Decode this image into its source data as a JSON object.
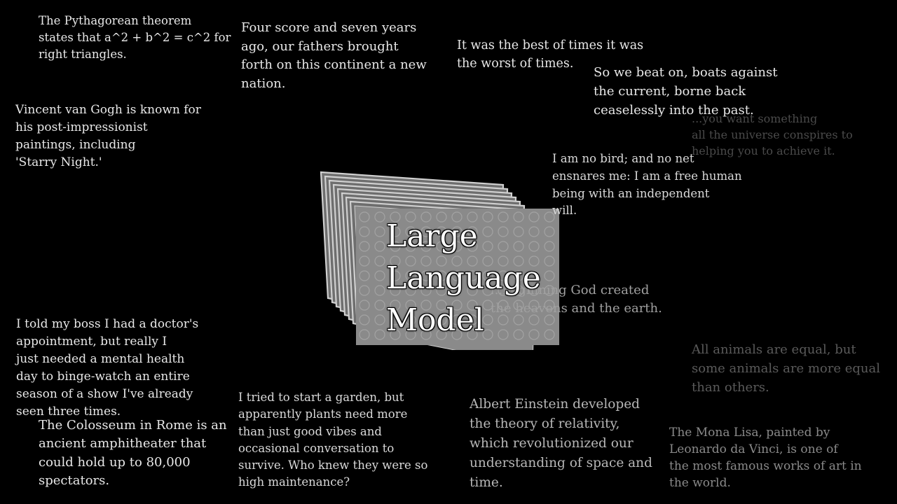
{
  "quotes": {
    "pythagorean": "The Pythagorean theorem\nstates that a^2 + b^2 = c^2 for\nright triangles.",
    "lincoln": "Four score and seven years\nago, our fathers brought\nforth on this continent a new\nnation.",
    "dickens": "It was the best of times it was\nthe worst of times.",
    "gatsby": "So we beat on, boats against\nthe current, borne back\nceaselessly into the past.",
    "faded_partial": "...you want something\nall the universe conspires to\nhelping you to achieve it.",
    "vangogh": "Vincent van Gogh is known for\nhis post-impressionist\npaintings, including\n'Starry Night.'",
    "bronte": "I am no bird; and no net\nensnares me: I am a free human\nbeing with an independent\nwill.",
    "genesis": "...beginning God created\nthe heavens and the earth.",
    "animals": "All animals are equal, but\nsome animals are more equal\nthan others.",
    "boss": "I told my boss I had a doctor's\nappointment, but really I\njust needed a mental health\nday to binge-watch an entire\nseason of a show I've already\nseen three times.",
    "colosseum": "The Colosseum in Rome is an\nancient amphitheater that\ncould hold up to 80,000\nspectators.",
    "garden": "I tried to start a garden, but\napparently plants need more\nthan just good vibes and\noccasional conversation to\nsurvive. Who knew they were so\nhigh maintenance?",
    "einstein": "Albert Einstein developed\nthe theory of relativity,\nwhich revolutionized our\nunderstanding of space and\ntime.",
    "monalisa": "The Mona Lisa, painted by\nLeonardo da Vinci, is one of\nthe most famous works of art in\nthe world."
  },
  "model": {
    "title": "Large\nLanguage\nModel"
  },
  "colors": {
    "background": "#000000",
    "text": "#e8e8e8",
    "block_face": "#8a8a8a",
    "block_edge": "#d0d0d0"
  }
}
